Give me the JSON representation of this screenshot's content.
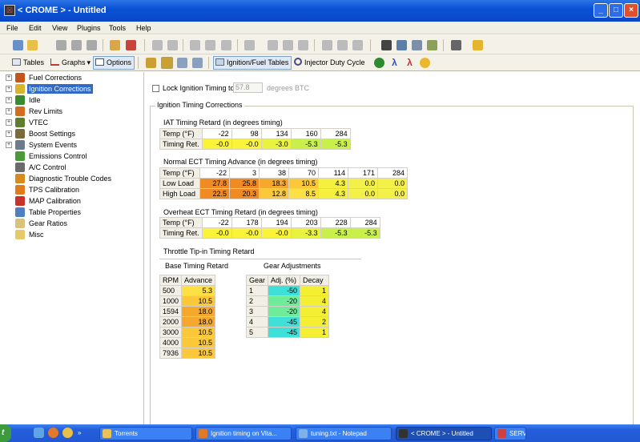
{
  "window": {
    "title": "< CROME > - Untitled",
    "icon": "crome-app-icon"
  },
  "window_controls": {
    "minimize": "_",
    "maximize": "□",
    "close": "×"
  },
  "menu": [
    "File",
    "Edit",
    "View",
    "Plugins",
    "Tools",
    "Help"
  ],
  "toolbar2": {
    "tables": "Tables",
    "graphs": "Graphs",
    "options": "Options",
    "ignition_fuel": "Ignition/Fuel Tables",
    "injector": "Injector Duty Cycle"
  },
  "tree": [
    {
      "label": "Fuel Corrections",
      "expand": "+",
      "icon_color": "#c5561b"
    },
    {
      "label": "Ignition Corrections",
      "expand": "+",
      "icon_color": "#d8b52c",
      "selected": true
    },
    {
      "label": "Idle",
      "expand": "+",
      "icon_color": "#3a8a2f"
    },
    {
      "label": "Rev Limits",
      "expand": "+",
      "icon_color": "#d46c1e"
    },
    {
      "label": "VTEC",
      "expand": "+",
      "icon_color": "#5d7d2f"
    },
    {
      "label": "Boost Settings",
      "expand": "+",
      "icon_color": "#7a6a3c"
    },
    {
      "label": "System Events",
      "expand": "+",
      "icon_color": "#6e7b8c"
    },
    {
      "label": "Emissions Control",
      "expand": "",
      "icon_color": "#4a9a3a"
    },
    {
      "label": "A/C Control",
      "expand": "",
      "icon_color": "#6b6b6b"
    },
    {
      "label": "Diagnostic Trouble Codes",
      "expand": "",
      "icon_color": "#d88a1a"
    },
    {
      "label": "TPS Calibration",
      "expand": "",
      "icon_color": "#e07c1c"
    },
    {
      "label": "MAP Calibration",
      "expand": "",
      "icon_color": "#c8322a"
    },
    {
      "label": "Table Properties",
      "expand": "",
      "icon_color": "#4f7fc0"
    },
    {
      "label": "Gear Ratios",
      "expand": "",
      "icon_color": "#d9c27a"
    },
    {
      "label": "Misc",
      "expand": "",
      "icon_color": "#e6c96a"
    }
  ],
  "lock": {
    "label": "Lock Ignition Timing to:",
    "value": "57.8",
    "unit": "degrees BTC"
  },
  "group_title": "Ignition Timing Corrections",
  "iat": {
    "title": "IAT Timing Retard (in degrees timing)",
    "row1_label": "Temp (°F)",
    "temps": [
      "-22",
      "98",
      "134",
      "160",
      "284"
    ],
    "row2_label": "Timing Ret.",
    "values": [
      "-0.0",
      "-0.0",
      "-3.0",
      "-5.3",
      "-5.3"
    ]
  },
  "ect": {
    "title": "Normal ECT Timing Advance (in degrees timing)",
    "row1_label": "Temp (°F)",
    "temps": [
      "-22",
      "3",
      "38",
      "70",
      "114",
      "171",
      "284"
    ],
    "low_label": "Low Load",
    "low": [
      "27.8",
      "25.8",
      "18.3",
      "10.5",
      "4.3",
      "0.0",
      "0.0"
    ],
    "high_label": "High Load",
    "high": [
      "22.5",
      "20.3",
      "12.8",
      "8.5",
      "4.3",
      "0.0",
      "0.0"
    ]
  },
  "overheat": {
    "title": "Overheat ECT Timing Retard (in degrees timing)",
    "row1_label": "Temp (°F)",
    "temps": [
      "-22",
      "178",
      "194",
      "203",
      "228",
      "284"
    ],
    "row2_label": "Timing Ret.",
    "values": [
      "-0.0",
      "-0.0",
      "-0.0",
      "-3.3",
      "-5.3",
      "-5.3"
    ]
  },
  "tipin": {
    "title": "Throttle Tip-in Timing Retard",
    "base_title": "Base Timing Retard",
    "rpm_header": "RPM",
    "adv_header": "Advance",
    "rows": [
      {
        "rpm": "500",
        "adv": "5.3"
      },
      {
        "rpm": "1000",
        "adv": "10.5"
      },
      {
        "rpm": "1594",
        "adv": "18.0"
      },
      {
        "rpm": "2000",
        "adv": "18.0"
      },
      {
        "rpm": "3000",
        "adv": "10.5"
      },
      {
        "rpm": "4000",
        "adv": "10.5"
      },
      {
        "rpm": "7936",
        "adv": "10.5"
      }
    ],
    "gear_title": "Gear Adjustments",
    "gear_header": "Gear",
    "adj_header": "Adj. (%)",
    "decay_header": "Decay",
    "gears": [
      {
        "gear": "1",
        "adj": "-50",
        "decay": "1"
      },
      {
        "gear": "2",
        "adj": "-20",
        "decay": "4"
      },
      {
        "gear": "3",
        "adj": "-20",
        "decay": "4"
      },
      {
        "gear": "4",
        "adj": "-45",
        "decay": "2"
      },
      {
        "gear": "5",
        "adj": "-45",
        "decay": "1"
      }
    ]
  },
  "taskbar": {
    "start": "t",
    "tasks": [
      {
        "label": "Torrents",
        "icon_color": "#e8c15a"
      },
      {
        "label": "Ignition timing on Vita...",
        "icon_color": "#e07a2a"
      },
      {
        "label": "tuning.txt - Notepad",
        "icon_color": "#7fb0e8"
      },
      {
        "label": "< CROME > - Untitled",
        "icon_color": "#333333",
        "active": true
      },
      {
        "label": "SERVER",
        "icon_color": "#d04040"
      }
    ]
  }
}
